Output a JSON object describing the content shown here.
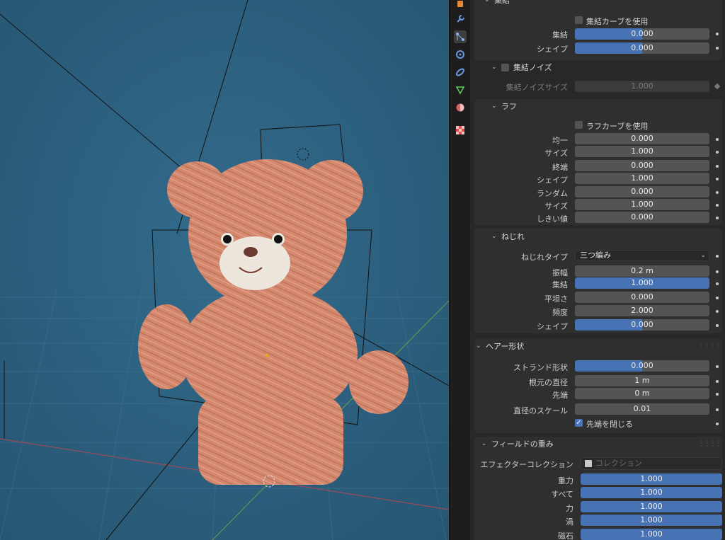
{
  "colors": {
    "accent": "#4772b3",
    "viewport_bg": "#2d5d7c",
    "panel_bg": "#2f2f2f",
    "field_bg": "#545454",
    "fur": "#d2876d"
  },
  "tabs": [
    {
      "icon": "object-data-icon"
    },
    {
      "icon": "wrench-modifier-icon"
    },
    {
      "icon": "particles-icon"
    },
    {
      "icon": "physics-icon"
    },
    {
      "icon": "constraints-icon"
    },
    {
      "icon": "mesh-data-icon"
    },
    {
      "icon": "material-icon"
    },
    {
      "icon": "texture-icon"
    }
  ],
  "clump": {
    "title": "集結",
    "use_curve_label": "集結カーブを使用",
    "rows": [
      {
        "label": "集結",
        "value": "0.000"
      },
      {
        "label": "シェイプ",
        "value": "0.000"
      }
    ]
  },
  "clump_noise": {
    "title": "集結ノイズ",
    "size_label": "集結ノイズサイズ",
    "size_value": "1.000"
  },
  "rough": {
    "title": "ラフ",
    "use_curve_label": "ラフカーブを使用",
    "rows": [
      {
        "label": "均一",
        "value": "0.000"
      },
      {
        "label": "サイズ",
        "value": "1.000"
      },
      {
        "label": "終端",
        "value": "0.000"
      },
      {
        "label": "シェイプ",
        "value": "1.000"
      },
      {
        "label": "ランダム",
        "value": "0.000"
      },
      {
        "label": "サイズ",
        "value": "1.000"
      },
      {
        "label": "しきい値",
        "value": "0.000"
      }
    ]
  },
  "kink": {
    "title": "ねじれ",
    "type_label": "ねじれタイプ",
    "type_value": "三つ編み",
    "rows": [
      {
        "label": "振幅",
        "value": "0.2 m"
      },
      {
        "label": "集結",
        "value": "1.000"
      },
      {
        "label": "平坦さ",
        "value": "0.000"
      },
      {
        "label": "頻度",
        "value": "2.000"
      },
      {
        "label": "シェイプ",
        "value": "0.000"
      }
    ]
  },
  "hair_shape": {
    "title": "ヘアー形状",
    "rows": [
      {
        "label": "ストランド形状",
        "value": "0.000"
      },
      {
        "label": "根元の直径",
        "value": "1 m"
      },
      {
        "label": "先端",
        "value": "0 m"
      },
      {
        "label": "直径のスケール",
        "value": "0.01"
      }
    ],
    "close_tip_label": "先端を閉じる"
  },
  "field_weights": {
    "title": "フィールドの重み",
    "collection_label": "エフェクターコレクション",
    "collection_placeholder": "コレクション",
    "rows": [
      {
        "label": "重力",
        "value": "1.000"
      },
      {
        "label": "すべて",
        "value": "1.000"
      },
      {
        "label": "力",
        "value": "1.000"
      },
      {
        "label": "渦",
        "value": "1.000"
      },
      {
        "label": "磁石",
        "value": "1.000"
      }
    ]
  }
}
